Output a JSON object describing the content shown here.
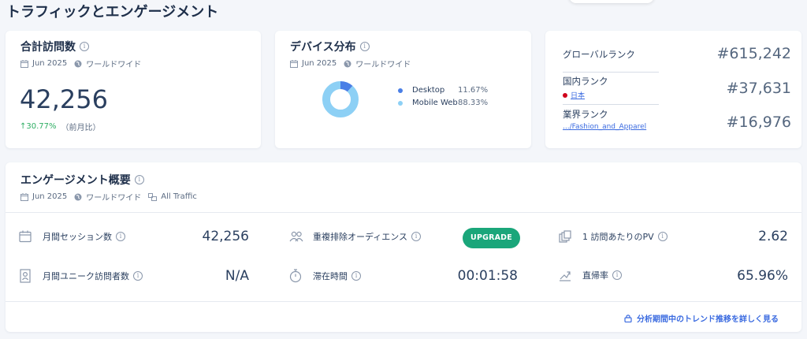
{
  "page": {
    "title": "トラフィックとエンゲージメント"
  },
  "visits": {
    "title": "合計訪問数",
    "date": "Jun 2025",
    "region": "ワールドワイド",
    "value": "42,256",
    "change": "↑30.77%",
    "change_note": "（前月比）"
  },
  "devices": {
    "title": "デバイス分布",
    "date": "Jun 2025",
    "region": "ワールドワイド",
    "items": [
      {
        "name": "Desktop",
        "value": "11.67%",
        "color": "#4a7fe6"
      },
      {
        "name": "Mobile Web",
        "value": "88.33%",
        "color": "#8dd0f5"
      }
    ],
    "chart_data": {
      "type": "pie",
      "categories": [
        "Desktop",
        "Mobile Web"
      ],
      "values": [
        11.67,
        88.33
      ],
      "colors": [
        "#4a7fe6",
        "#8dd0f5"
      ]
    }
  },
  "ranks": {
    "global": {
      "label": "グローバルランク",
      "value": "#615,242"
    },
    "country": {
      "label": "国内ランク",
      "sub": "日本",
      "value": "#37,631"
    },
    "industry": {
      "label": "業界ランク",
      "sub": ".../Fashion_and_Apparel",
      "value": "#16,976"
    }
  },
  "engagement": {
    "title": "エンゲージメント概要",
    "date": "Jun 2025",
    "region": "ワールドワイド",
    "traffic": "All Traffic",
    "metrics": {
      "monthly_sessions": {
        "label": "月間セッション数",
        "value": "42,256"
      },
      "unique_visitors": {
        "label": "月間ユニーク訪問者数",
        "value": "N/A"
      },
      "dedup_audience": {
        "label": "重複排除オーディエンス",
        "button": "UPGRADE"
      },
      "duration": {
        "label": "滞在時間",
        "value": "00:01:58"
      },
      "pages_per_visit": {
        "label": "1 訪問あたりのPV",
        "value": "2.62"
      },
      "bounce_rate": {
        "label": "直帰率",
        "value": "65.96%"
      }
    },
    "footer_link": "分析期間中のトレンド推移を詳しく見る"
  }
}
